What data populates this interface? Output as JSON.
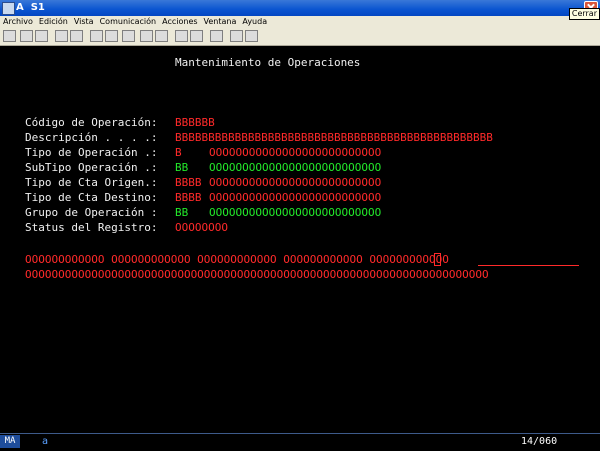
{
  "window": {
    "title": "A  S1",
    "tooltip": "Cerrar"
  },
  "menu": [
    "Archivo",
    "Edición",
    "Vista",
    "Comunicación",
    "Acciones",
    "Ventana",
    "Ayuda"
  ],
  "screen": {
    "heading": "Mantenimiento de Operaciones",
    "fields": [
      {
        "label": "Código de Operación:",
        "value": "BBBBBB",
        "desc": ""
      },
      {
        "label": "Descripción . . . .:",
        "value": "BBBBBBBBBBBBBBBBBBBBBBBBBBBBBBBBBBBBBBBBBBBBBBBB",
        "desc": ""
      },
      {
        "label": "Tipo de Operación .:",
        "value": "B   ",
        "desc": "OOOOOOOOOOOOOOOOOOOOOOOOOO"
      },
      {
        "label": "SubTipo Operación .:",
        "value": "BB  ",
        "desc": "OOOOOOOOOOOOOOOOOOOOOOOOOO"
      },
      {
        "label": "Tipo de Cta Origen.:",
        "value": "BBBB",
        "desc": "OOOOOOOOOOOOOOOOOOOOOOOOOO"
      },
      {
        "label": "Tipo de Cta Destino:",
        "value": "BBBB",
        "desc": "OOOOOOOOOOOOOOOOOOOOOOOOOO"
      },
      {
        "label": "Grupo de Operación :",
        "value": "BB  ",
        "desc": "OOOOOOOOOOOOOOOOOOOOOOOOOO"
      },
      {
        "label": "Status del Registro:",
        "value": "OOOOOOOO",
        "desc": ""
      }
    ],
    "message_line1": "OOOOOOOOOOOO OOOOOOOOOOOO OOOOOOOOOOOO OOOOOOOOOOOO OOOOOOOOOOOO",
    "message_line2": "OOOOOOOOOOOOOOOOOOOOOOOOOOOOOOOOOOOOOOOOOOOOOOOOOOOOOOOOOOOOOOOOOOOOOO"
  },
  "status": {
    "indicator": "MA",
    "mode": "a",
    "position": "14/060"
  },
  "colors": {
    "label": "#f0f0f0",
    "input": "#ff2a2a",
    "output": "#22e82a",
    "background": "#000000"
  }
}
